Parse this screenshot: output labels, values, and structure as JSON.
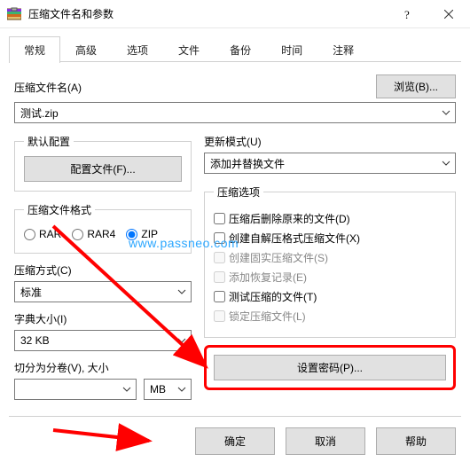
{
  "window": {
    "title": "压缩文件名和参数"
  },
  "tabs": [
    "常规",
    "高级",
    "选项",
    "文件",
    "备份",
    "时间",
    "注释"
  ],
  "activeTabIndex": 0,
  "archive": {
    "name_label": "压缩文件名(A)",
    "name_value": "测试.zip",
    "browse_label": "浏览(B)..."
  },
  "profile": {
    "legend": "默认配置",
    "button": "配置文件(F)..."
  },
  "update": {
    "label": "更新模式(U)",
    "value": "添加并替换文件"
  },
  "format": {
    "legend": "压缩文件格式",
    "options": [
      "RAR",
      "RAR4",
      "ZIP"
    ],
    "selected": "ZIP"
  },
  "method": {
    "label": "压缩方式(C)",
    "value": "标准"
  },
  "dict": {
    "label": "字典大小(I)",
    "value": "32 KB"
  },
  "split": {
    "label": "切分为分卷(V), 大小",
    "unit": "MB",
    "value": ""
  },
  "options": {
    "legend": "压缩选项",
    "items": [
      {
        "label": "压缩后删除原来的文件(D)",
        "checked": false,
        "disabled": false
      },
      {
        "label": "创建自解压格式压缩文件(X)",
        "checked": false,
        "disabled": false
      },
      {
        "label": "创建固实压缩文件(S)",
        "checked": false,
        "disabled": true
      },
      {
        "label": "添加恢复记录(E)",
        "checked": false,
        "disabled": true
      },
      {
        "label": "测试压缩的文件(T)",
        "checked": false,
        "disabled": false
      },
      {
        "label": "锁定压缩文件(L)",
        "checked": false,
        "disabled": true
      }
    ]
  },
  "password_button": "设置密码(P)...",
  "buttons": {
    "ok": "确定",
    "cancel": "取消",
    "help": "帮助"
  },
  "watermark": "www.passneo.com",
  "colors": {
    "highlight_red": "#ff0000",
    "link_blue": "#2aa6ff"
  }
}
